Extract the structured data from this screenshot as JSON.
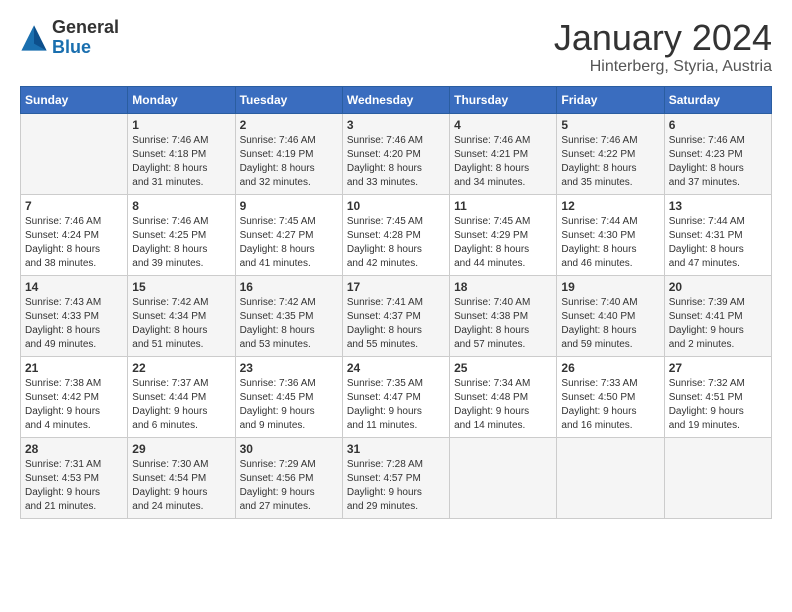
{
  "logo": {
    "line1": "General",
    "line2": "Blue"
  },
  "title": "January 2024",
  "subtitle": "Hinterberg, Styria, Austria",
  "weekdays": [
    "Sunday",
    "Monday",
    "Tuesday",
    "Wednesday",
    "Thursday",
    "Friday",
    "Saturday"
  ],
  "weeks": [
    [
      {
        "day": "",
        "details": ""
      },
      {
        "day": "1",
        "details": "Sunrise: 7:46 AM\nSunset: 4:18 PM\nDaylight: 8 hours\nand 31 minutes."
      },
      {
        "day": "2",
        "details": "Sunrise: 7:46 AM\nSunset: 4:19 PM\nDaylight: 8 hours\nand 32 minutes."
      },
      {
        "day": "3",
        "details": "Sunrise: 7:46 AM\nSunset: 4:20 PM\nDaylight: 8 hours\nand 33 minutes."
      },
      {
        "day": "4",
        "details": "Sunrise: 7:46 AM\nSunset: 4:21 PM\nDaylight: 8 hours\nand 34 minutes."
      },
      {
        "day": "5",
        "details": "Sunrise: 7:46 AM\nSunset: 4:22 PM\nDaylight: 8 hours\nand 35 minutes."
      },
      {
        "day": "6",
        "details": "Sunrise: 7:46 AM\nSunset: 4:23 PM\nDaylight: 8 hours\nand 37 minutes."
      }
    ],
    [
      {
        "day": "7",
        "details": "Sunrise: 7:46 AM\nSunset: 4:24 PM\nDaylight: 8 hours\nand 38 minutes."
      },
      {
        "day": "8",
        "details": "Sunrise: 7:46 AM\nSunset: 4:25 PM\nDaylight: 8 hours\nand 39 minutes."
      },
      {
        "day": "9",
        "details": "Sunrise: 7:45 AM\nSunset: 4:27 PM\nDaylight: 8 hours\nand 41 minutes."
      },
      {
        "day": "10",
        "details": "Sunrise: 7:45 AM\nSunset: 4:28 PM\nDaylight: 8 hours\nand 42 minutes."
      },
      {
        "day": "11",
        "details": "Sunrise: 7:45 AM\nSunset: 4:29 PM\nDaylight: 8 hours\nand 44 minutes."
      },
      {
        "day": "12",
        "details": "Sunrise: 7:44 AM\nSunset: 4:30 PM\nDaylight: 8 hours\nand 46 minutes."
      },
      {
        "day": "13",
        "details": "Sunrise: 7:44 AM\nSunset: 4:31 PM\nDaylight: 8 hours\nand 47 minutes."
      }
    ],
    [
      {
        "day": "14",
        "details": "Sunrise: 7:43 AM\nSunset: 4:33 PM\nDaylight: 8 hours\nand 49 minutes."
      },
      {
        "day": "15",
        "details": "Sunrise: 7:42 AM\nSunset: 4:34 PM\nDaylight: 8 hours\nand 51 minutes."
      },
      {
        "day": "16",
        "details": "Sunrise: 7:42 AM\nSunset: 4:35 PM\nDaylight: 8 hours\nand 53 minutes."
      },
      {
        "day": "17",
        "details": "Sunrise: 7:41 AM\nSunset: 4:37 PM\nDaylight: 8 hours\nand 55 minutes."
      },
      {
        "day": "18",
        "details": "Sunrise: 7:40 AM\nSunset: 4:38 PM\nDaylight: 8 hours\nand 57 minutes."
      },
      {
        "day": "19",
        "details": "Sunrise: 7:40 AM\nSunset: 4:40 PM\nDaylight: 8 hours\nand 59 minutes."
      },
      {
        "day": "20",
        "details": "Sunrise: 7:39 AM\nSunset: 4:41 PM\nDaylight: 9 hours\nand 2 minutes."
      }
    ],
    [
      {
        "day": "21",
        "details": "Sunrise: 7:38 AM\nSunset: 4:42 PM\nDaylight: 9 hours\nand 4 minutes."
      },
      {
        "day": "22",
        "details": "Sunrise: 7:37 AM\nSunset: 4:44 PM\nDaylight: 9 hours\nand 6 minutes."
      },
      {
        "day": "23",
        "details": "Sunrise: 7:36 AM\nSunset: 4:45 PM\nDaylight: 9 hours\nand 9 minutes."
      },
      {
        "day": "24",
        "details": "Sunrise: 7:35 AM\nSunset: 4:47 PM\nDaylight: 9 hours\nand 11 minutes."
      },
      {
        "day": "25",
        "details": "Sunrise: 7:34 AM\nSunset: 4:48 PM\nDaylight: 9 hours\nand 14 minutes."
      },
      {
        "day": "26",
        "details": "Sunrise: 7:33 AM\nSunset: 4:50 PM\nDaylight: 9 hours\nand 16 minutes."
      },
      {
        "day": "27",
        "details": "Sunrise: 7:32 AM\nSunset: 4:51 PM\nDaylight: 9 hours\nand 19 minutes."
      }
    ],
    [
      {
        "day": "28",
        "details": "Sunrise: 7:31 AM\nSunset: 4:53 PM\nDaylight: 9 hours\nand 21 minutes."
      },
      {
        "day": "29",
        "details": "Sunrise: 7:30 AM\nSunset: 4:54 PM\nDaylight: 9 hours\nand 24 minutes."
      },
      {
        "day": "30",
        "details": "Sunrise: 7:29 AM\nSunset: 4:56 PM\nDaylight: 9 hours\nand 27 minutes."
      },
      {
        "day": "31",
        "details": "Sunrise: 7:28 AM\nSunset: 4:57 PM\nDaylight: 9 hours\nand 29 minutes."
      },
      {
        "day": "",
        "details": ""
      },
      {
        "day": "",
        "details": ""
      },
      {
        "day": "",
        "details": ""
      }
    ]
  ]
}
